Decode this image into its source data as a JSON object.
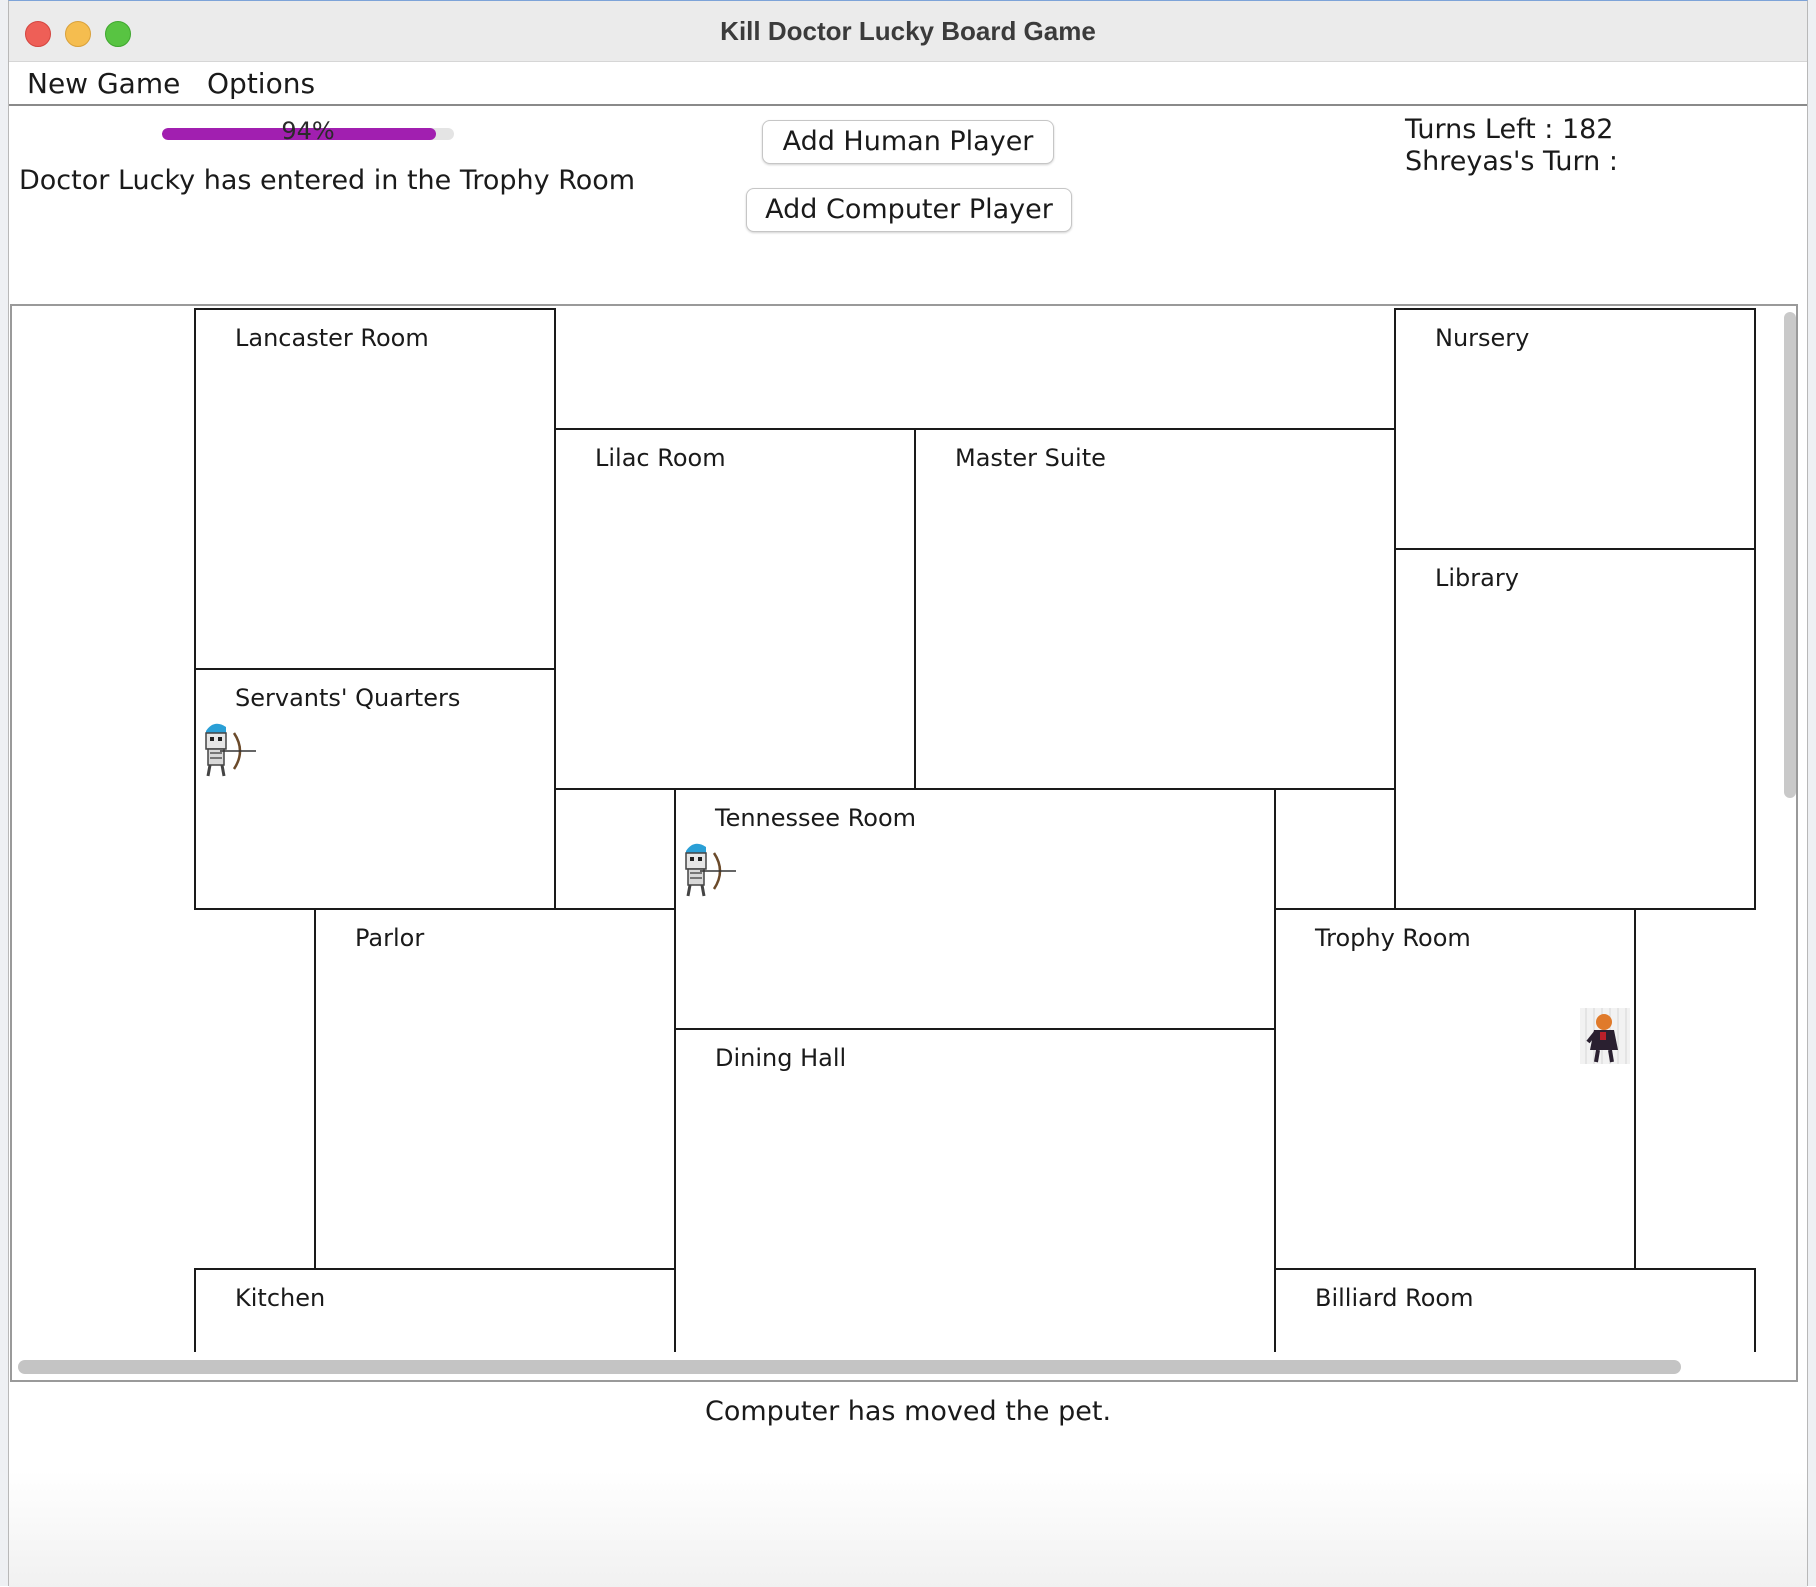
{
  "window": {
    "title": "Kill Doctor Lucky Board Game"
  },
  "menu": {
    "new_game": "New Game",
    "options": "Options"
  },
  "progress": {
    "value_percent": 94,
    "label": "94%",
    "color": "#a11fb0"
  },
  "status": {
    "doctor_location": "Doctor Lucky has entered in the Trophy Room"
  },
  "buttons": {
    "add_human": "Add Human Player",
    "add_computer": "Add Computer Player"
  },
  "turn_info": {
    "turns_left": "Turns Left : 182",
    "current_turn": "Shreyas's Turn :"
  },
  "board": {
    "rooms": [
      {
        "name": "Lancaster Room"
      },
      {
        "name": "Nursery"
      },
      {
        "name": "Lilac Room"
      },
      {
        "name": "Master Suite"
      },
      {
        "name": "Library"
      },
      {
        "name": "Servants' Quarters"
      },
      {
        "name": "Tennessee Room"
      },
      {
        "name": "Parlor"
      },
      {
        "name": "Trophy Room"
      },
      {
        "name": "Dining Hall"
      },
      {
        "name": "Kitchen"
      },
      {
        "name": "Billiard Room"
      }
    ],
    "tokens": [
      {
        "icon": "skeleton-archer-player-icon",
        "room": "Servants' Quarters"
      },
      {
        "icon": "skeleton-archer-player-icon",
        "room": "Tennessee Room"
      },
      {
        "icon": "doctor-lucky-character-icon",
        "room": "Trophy Room"
      }
    ]
  },
  "message": "Computer has moved the pet."
}
